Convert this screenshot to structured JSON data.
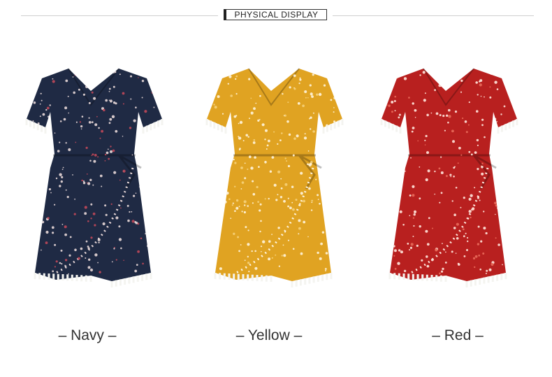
{
  "header": {
    "title": "PHYSICAL DISPLAY"
  },
  "products": [
    {
      "label": "– Navy –",
      "color": "#1f2a44",
      "print": "#e8d8d8",
      "accent": "#c0485a"
    },
    {
      "label": "– Yellow –",
      "color": "#e0a322",
      "print": "#fff4dc",
      "accent": "#f6d27a"
    },
    {
      "label": "– Red –",
      "color": "#b8201f",
      "print": "#ffe6dc",
      "accent": "#e96a5a"
    }
  ]
}
